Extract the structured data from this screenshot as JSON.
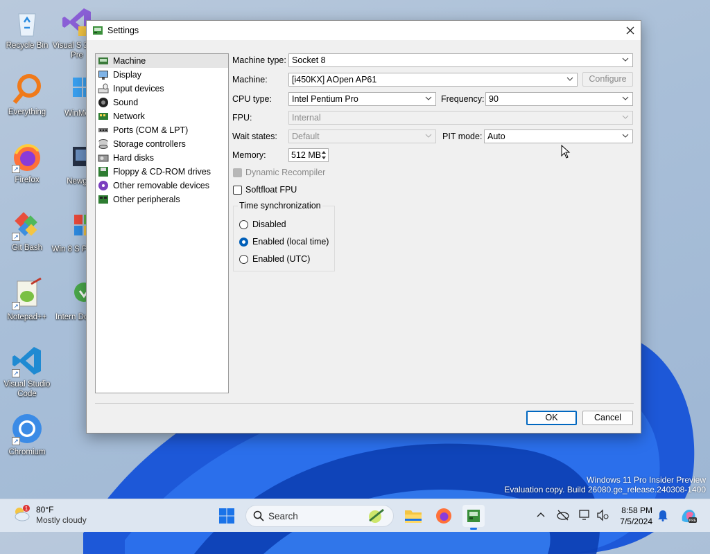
{
  "desktop": {
    "icons": [
      {
        "label": "Recycle Bin",
        "icon": "recycle-bin-icon"
      },
      {
        "label": "Visual S 2022 Pre",
        "icon": "visual-studio-icon"
      },
      {
        "label": "Everything",
        "icon": "everything-search-icon"
      },
      {
        "label": "WinMe",
        "icon": "windows-icon"
      },
      {
        "label": "Firefox",
        "icon": "firefox-icon"
      },
      {
        "label": "Newg",
        "icon": "app-icon"
      },
      {
        "label": "Git Bash",
        "icon": "git-bash-icon"
      },
      {
        "label": "Win 8 S Panel",
        "icon": "windows-panel-icon"
      },
      {
        "label": "Notepad++",
        "icon": "notepad-plus-plus-icon"
      },
      {
        "label": "Intern Down",
        "icon": "internet-download-icon"
      },
      {
        "label": "Visual Studio Code",
        "icon": "vscode-icon"
      },
      {
        "label": "Chromium",
        "icon": "chromium-icon"
      }
    ],
    "watermark_line1": "Windows 11 Pro Insider Preview",
    "watermark_line2": "Evaluation copy. Build 26080.ge_release.240308-1400"
  },
  "dialog": {
    "title": "Settings",
    "nav": [
      {
        "label": "Machine",
        "icon": "machine-icon",
        "selected": true
      },
      {
        "label": "Display",
        "icon": "display-icon"
      },
      {
        "label": "Input devices",
        "icon": "input-devices-icon"
      },
      {
        "label": "Sound",
        "icon": "sound-icon"
      },
      {
        "label": "Network",
        "icon": "network-icon"
      },
      {
        "label": "Ports (COM & LPT)",
        "icon": "ports-icon"
      },
      {
        "label": "Storage controllers",
        "icon": "storage-icon"
      },
      {
        "label": "Hard disks",
        "icon": "hard-disk-icon"
      },
      {
        "label": "Floppy & CD-ROM drives",
        "icon": "floppy-icon"
      },
      {
        "label": "Other removable devices",
        "icon": "removable-icon"
      },
      {
        "label": "Other peripherals",
        "icon": "peripherals-icon"
      }
    ],
    "machine_type_label": "Machine type:",
    "machine_type_value": "Socket 8",
    "machine_label": "Machine:",
    "machine_value": "[i450KX] AOpen AP61",
    "configure_label": "Configure",
    "cpu_type_label": "CPU type:",
    "cpu_type_value": "Intel Pentium Pro",
    "frequency_label": "Frequency:",
    "frequency_value": "90",
    "fpu_label": "FPU:",
    "fpu_value": "Internal",
    "wait_states_label": "Wait states:",
    "wait_states_value": "Default",
    "pit_mode_label": "PIT mode:",
    "pit_mode_value": "Auto",
    "memory_label": "Memory:",
    "memory_value": "512 MB",
    "dynamic_recompiler_label": "Dynamic Recompiler",
    "softfloat_label": "Softfloat FPU",
    "time_sync_title": "Time synchronization",
    "time_sync_options": [
      "Disabled",
      "Enabled (local time)",
      "Enabled (UTC)"
    ],
    "time_sync_selected": "Enabled (local time)",
    "ok_label": "OK",
    "cancel_label": "Cancel"
  },
  "taskbar": {
    "weather_temp": "80°F",
    "weather_desc": "Mostly cloudy",
    "weather_badge": "1",
    "search_placeholder": "Search",
    "time": "8:58 PM",
    "date": "7/5/2024"
  }
}
